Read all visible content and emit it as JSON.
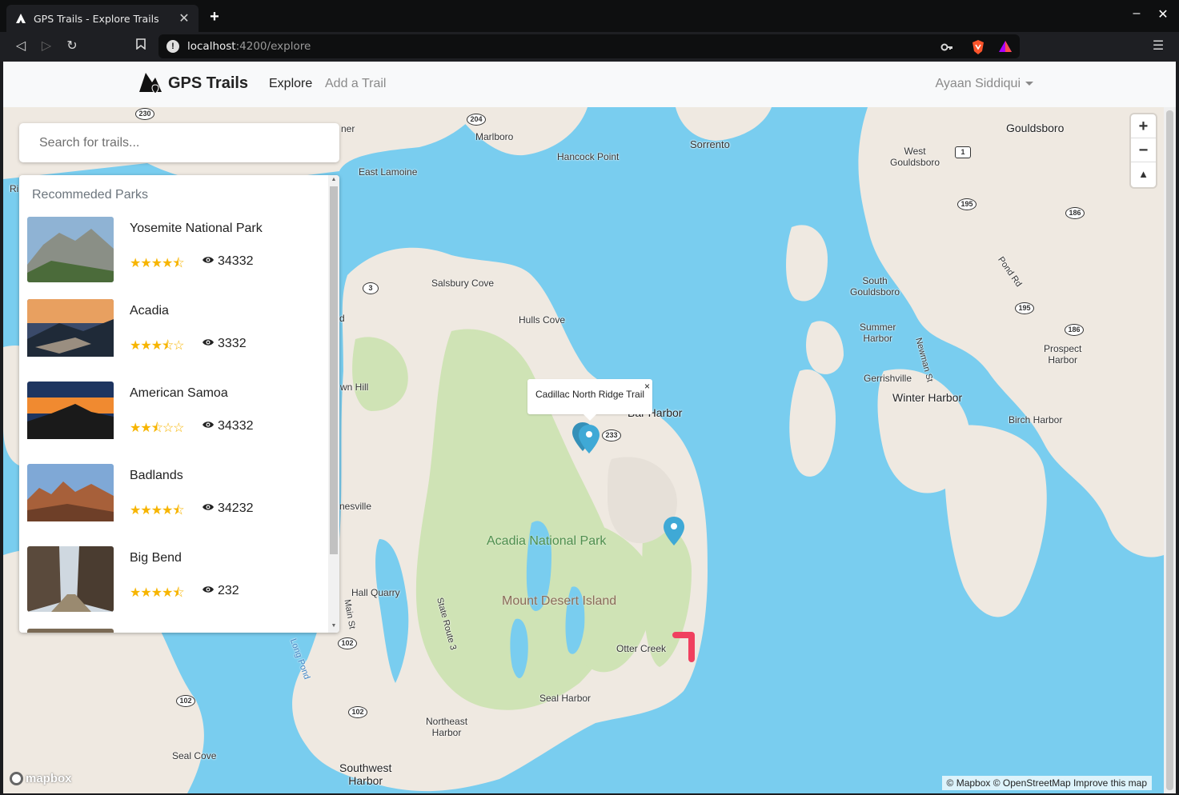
{
  "browser": {
    "tab_title": "GPS Trails - Explore Trails",
    "url_host": "localhost",
    "url_rest": ":4200/explore"
  },
  "navbar": {
    "brand": "GPS Trails",
    "links": [
      "Explore",
      "Add a Trail"
    ],
    "user": "Ayaan Siddiqui"
  },
  "search": {
    "placeholder": "Search for trails..."
  },
  "recommended": {
    "title": "Recommeded Parks",
    "parks": [
      {
        "name": "Yosemite National Park",
        "rating": 4.5,
        "stars": "★★★★⯪",
        "views": "34332"
      },
      {
        "name": "Acadia",
        "rating": 3.5,
        "stars": "★★★⯪☆",
        "views": "3332"
      },
      {
        "name": "American Samoa",
        "rating": 2.5,
        "stars": "★★⯪☆☆",
        "views": "34332"
      },
      {
        "name": "Badlands",
        "rating": 4.5,
        "stars": "★★★★⯪",
        "views": "34232"
      },
      {
        "name": "Big Bend",
        "rating": 4.5,
        "stars": "★★★★⯪",
        "views": "232"
      }
    ]
  },
  "map": {
    "popup_text": "Cadillac North Ridge Trail",
    "popup_close": "×",
    "zoom_in": "+",
    "zoom_out": "−",
    "compass": "▲",
    "attribution": "© Mapbox © OpenStreetMap Improve this map",
    "logo": "mapbox",
    "labels": {
      "gouldsboro": "Gouldsboro",
      "sorrento": "Sorrento",
      "marlboro": "Marlboro",
      "hancock_point": "Hancock Point",
      "east_lamoine": "East Lamoine",
      "west_gouldsboro": "West\nGouldsboro",
      "salsbury_cove": "Salsbury Cove",
      "hulls_cove": "Hulls Cove",
      "south_gouldsboro": "South\nGouldsboro",
      "summer_harbor": "Summer\nHarbor",
      "prospect_harbor": "Prospect\nHarbor",
      "gerrishville": "Gerrishville",
      "winter_harbor": "Winter Harbor",
      "birch_harbor": "Birch Harbor",
      "bar_harbor": "Bar Harbor",
      "acadia_np": "Acadia National Park",
      "mount_desert": "Mount Desert Island",
      "hall_quarry": "Hall Quarry",
      "otter_creek": "Otter Creek",
      "seal_harbor": "Seal Harbor",
      "northeast_harbor": "Northeast\nHarbor",
      "southwest_harbor": "Southwest\nHarbor",
      "seal_cove": "Seal Cove",
      "state_route_3": "State Route 3",
      "main_st": "Main St",
      "long_pond": "Long Pond",
      "pond_rd": "Pond Rd",
      "newman_st": "Newman St",
      "town_hill": "wn Hill",
      "somesville": "nesville",
      "ner": "ner",
      "ri": "Ri",
      "d": "d"
    },
    "shields": [
      "230",
      "204",
      "1",
      "195",
      "186",
      "3",
      "233",
      "195",
      "186",
      "102",
      "102",
      "102"
    ]
  },
  "colors": {
    "water": "#79cdef",
    "land": "#efe9e1",
    "park": "#cfe3b5",
    "marker": "#3fa9d6",
    "trail": "#f0405f",
    "star": "#f7b500"
  }
}
